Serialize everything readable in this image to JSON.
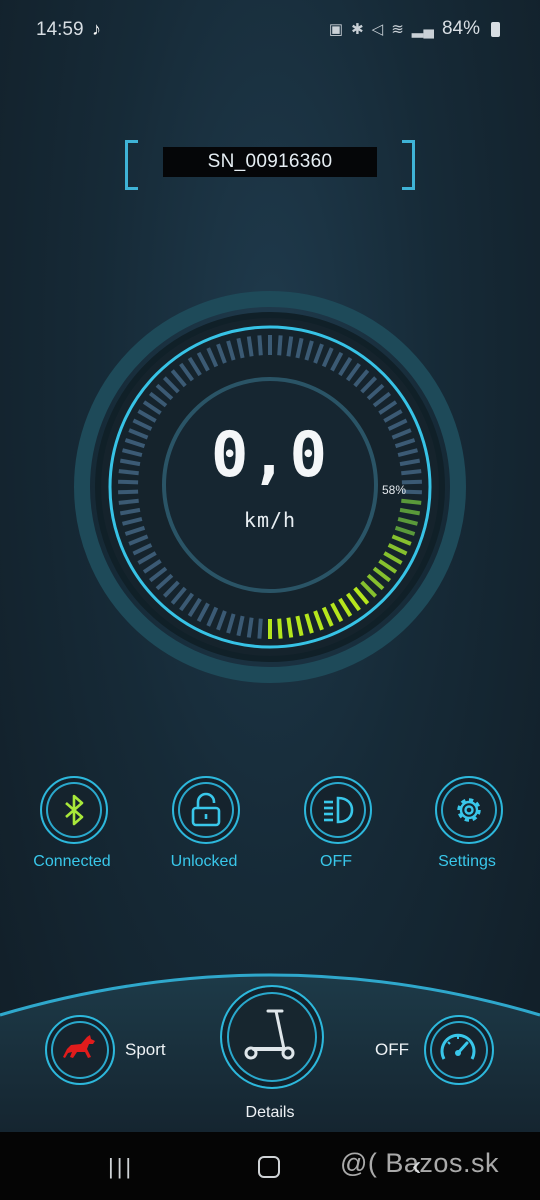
{
  "status_bar": {
    "time": "14:59",
    "battery": "84%"
  },
  "serial_number": "SN_00916360",
  "speedometer": {
    "speed": "0,0",
    "unit": "km/h",
    "battery_percent_label": "58%",
    "battery_level": 0.58
  },
  "actions": [
    {
      "label": "Connected",
      "icon": "bluetooth-icon"
    },
    {
      "label": "Unlocked",
      "icon": "unlock-icon"
    },
    {
      "label": "OFF",
      "icon": "headlight-icon"
    },
    {
      "label": "Settings",
      "icon": "gear-icon"
    }
  ],
  "bottom": {
    "mode_label": "Sport",
    "mode_icon": "horse-icon",
    "details_label": "Details",
    "details_icon": "scooter-icon",
    "cruise_label": "OFF",
    "cruise_icon": "speedometer-icon"
  },
  "watermark": "@( Bazos.sk",
  "colors": {
    "accent": "#2db8dc",
    "battery_fill": "#a6d62a",
    "background": "#162a37"
  }
}
